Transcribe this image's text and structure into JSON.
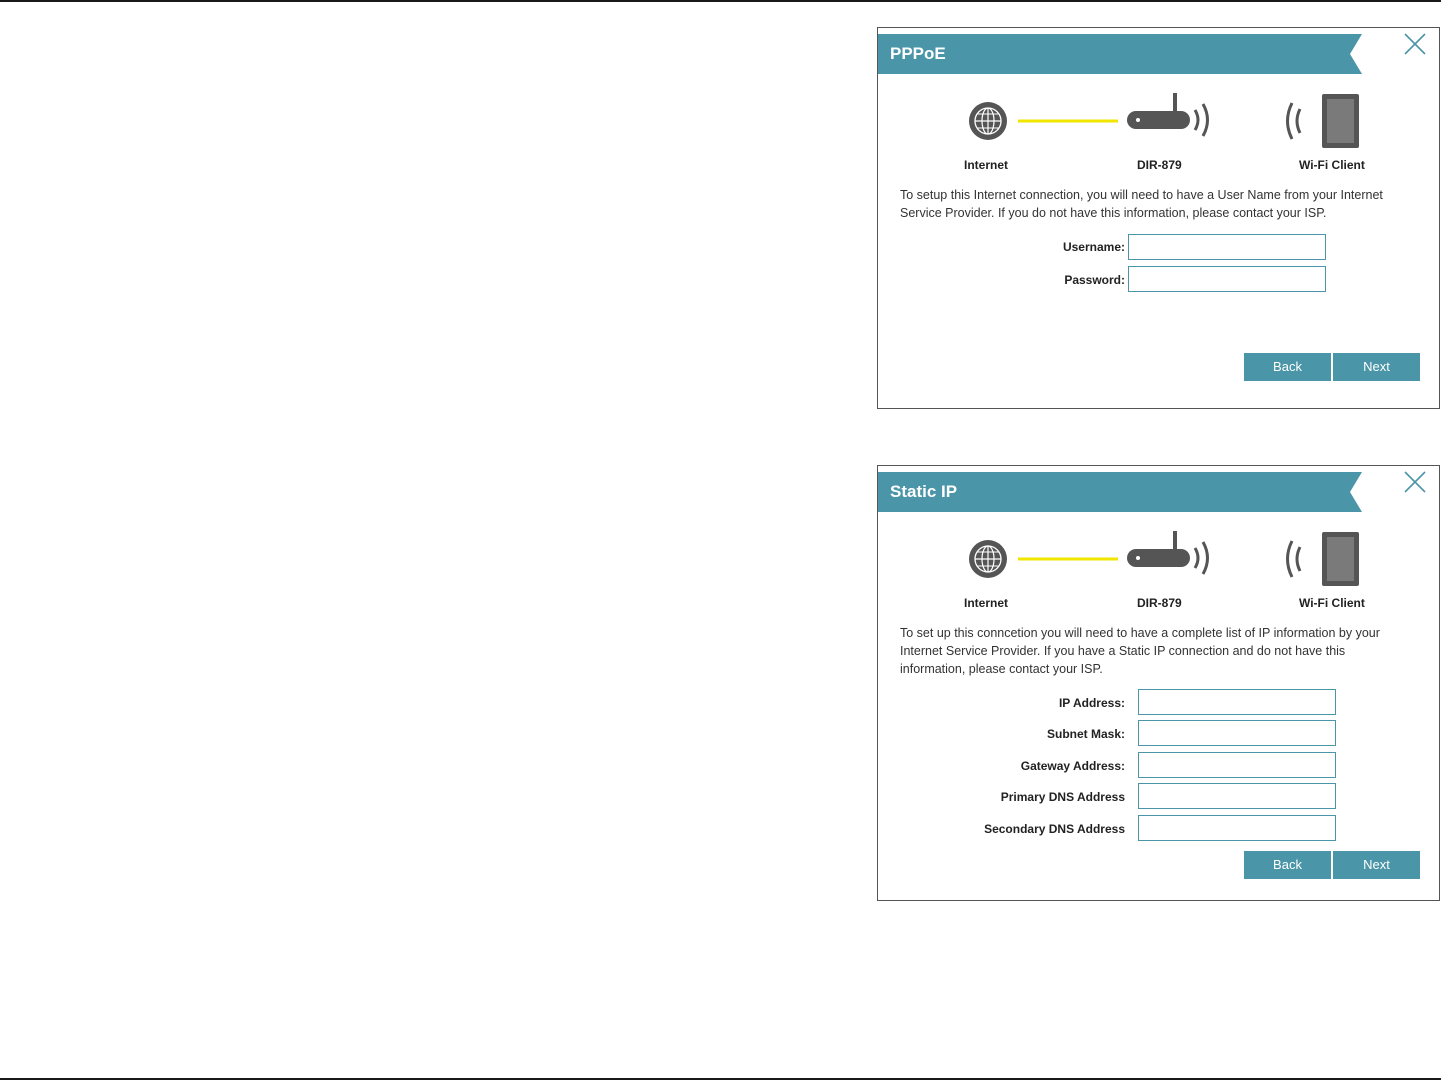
{
  "colors": {
    "accent": "#4a96a8",
    "connection_line": "#f2e600",
    "icon_gray": "#555555"
  },
  "diagram_labels": {
    "internet": "Internet",
    "router": "DIR-879",
    "client": "Wi-Fi Client"
  },
  "pppoe": {
    "title": "PPPoE",
    "description": "To setup this Internet connection, you will need to have a User Name from your Internet Service Provider. If you do not have this information, please contact your ISP.",
    "fields": [
      {
        "label": "Username:",
        "value": ""
      },
      {
        "label": "Password:",
        "value": ""
      }
    ],
    "back_label": "Back",
    "next_label": "Next"
  },
  "static_ip": {
    "title": "Static IP",
    "description": "To set up this conncetion you will need to have a complete list of IP information by your Internet Service Provider. If you have a Static IP connection and do not have this information, please contact your ISP.",
    "fields": [
      {
        "label": "IP Address:",
        "value": ""
      },
      {
        "label": "Subnet Mask:",
        "value": ""
      },
      {
        "label": "Gateway Address:",
        "value": ""
      },
      {
        "label": "Primary DNS Address",
        "value": ""
      },
      {
        "label": "Secondary DNS Address",
        "value": ""
      }
    ],
    "back_label": "Back",
    "next_label": "Next"
  },
  "icons": [
    "close-icon",
    "globe-icon",
    "router-icon",
    "wifi-signal-icon",
    "phone-icon"
  ]
}
